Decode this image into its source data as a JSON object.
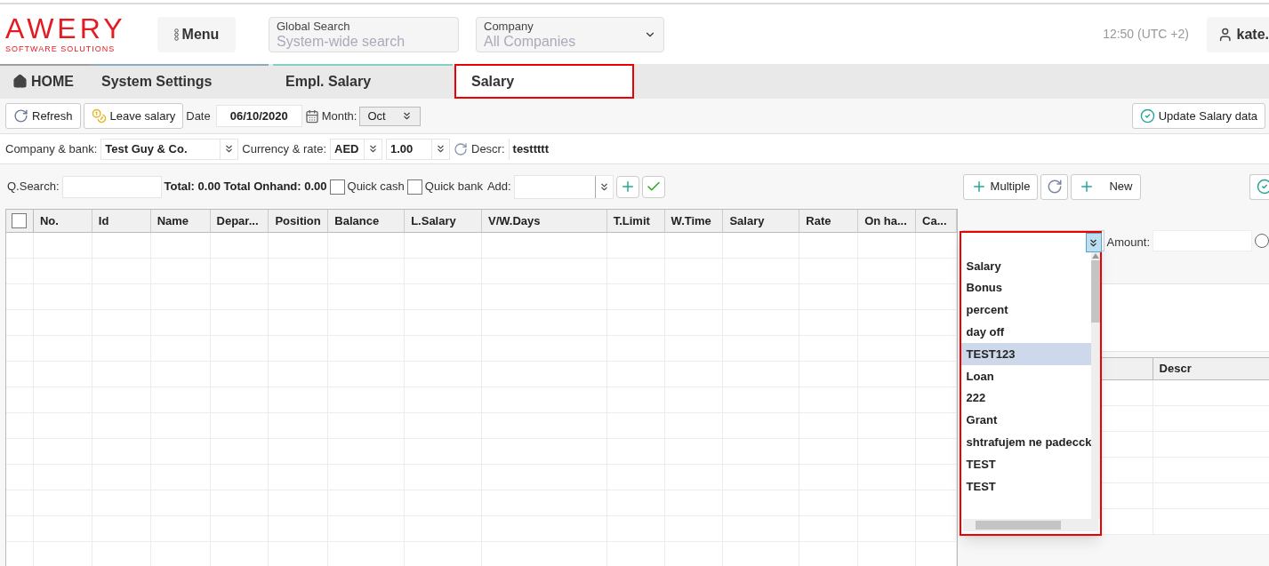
{
  "header": {
    "logo": {
      "name": "AWERY",
      "tagline": "SOFTWARE SOLUTIONS"
    },
    "menu_button": "Menu",
    "global_search": {
      "label": "Global Search",
      "placeholder": "System-wide search"
    },
    "company": {
      "label": "Company",
      "placeholder": "All Companies"
    },
    "clock": "12:50 (UTC +2)",
    "user": "kate."
  },
  "tabs": [
    {
      "label": "HOME",
      "kind": "home",
      "selected": false,
      "color": "#9e9e9e"
    },
    {
      "label": "System Settings",
      "kind": "page",
      "selected": false,
      "color": "#8fa9bd"
    },
    {
      "label": "Empl. Salary",
      "kind": "page",
      "selected": false,
      "color": "#7fd1c4"
    },
    {
      "label": "Salary",
      "kind": "page",
      "selected": true
    }
  ],
  "toolbar": {
    "refresh": "Refresh",
    "leave_salary": "Leave salary",
    "date_label": "Date",
    "date": "06/10/2020",
    "month_label": "Month:",
    "month": "Oct",
    "update": "Update Salary data"
  },
  "filters": {
    "company_bank": {
      "label": "Company & bank:",
      "value": "Test Guy & Co."
    },
    "currency": {
      "label": "Currency & rate:",
      "value": "AED"
    },
    "rate": "1.00",
    "descr": {
      "label": "Descr:",
      "value": "testtttt"
    }
  },
  "quick": {
    "search_label": "Q.Search:",
    "totals": "Total: 0.00 Total Onhand: 0.00",
    "quick_cash": {
      "label": "Quick cash",
      "checked": false
    },
    "quick_bank": {
      "label": "Quick bank",
      "checked": false
    },
    "add_label": "Add:"
  },
  "table": {
    "select_all": {
      "checked": false
    },
    "columns": [
      "No.",
      "Id",
      "Name",
      "Depar...",
      "Position",
      "Balance",
      "L.Salary",
      "V/W.Days",
      "T.Limit",
      "W.Time",
      "Salary",
      "Rate",
      "On ha...",
      "Ca..."
    ]
  },
  "right_panel": {
    "multiple": "Multiple",
    "new": "New",
    "amount_label": "Amount:",
    "radio": {
      "selected": false
    },
    "columns": [
      "Descr"
    ]
  },
  "dropdown": {
    "items": [
      {
        "label": "Salary",
        "selected": false
      },
      {
        "label": "Bonus",
        "selected": false
      },
      {
        "label": "percent",
        "selected": false
      },
      {
        "label": "day off",
        "selected": false
      },
      {
        "label": "TEST123",
        "selected": true
      },
      {
        "label": "Loan",
        "selected": false
      },
      {
        "label": "222",
        "selected": false
      },
      {
        "label": "Grant",
        "selected": false
      },
      {
        "label": "shtrafujem ne padecck",
        "selected": false
      },
      {
        "label": "TEST",
        "selected": false
      },
      {
        "label": "TEST",
        "selected": false
      }
    ]
  }
}
